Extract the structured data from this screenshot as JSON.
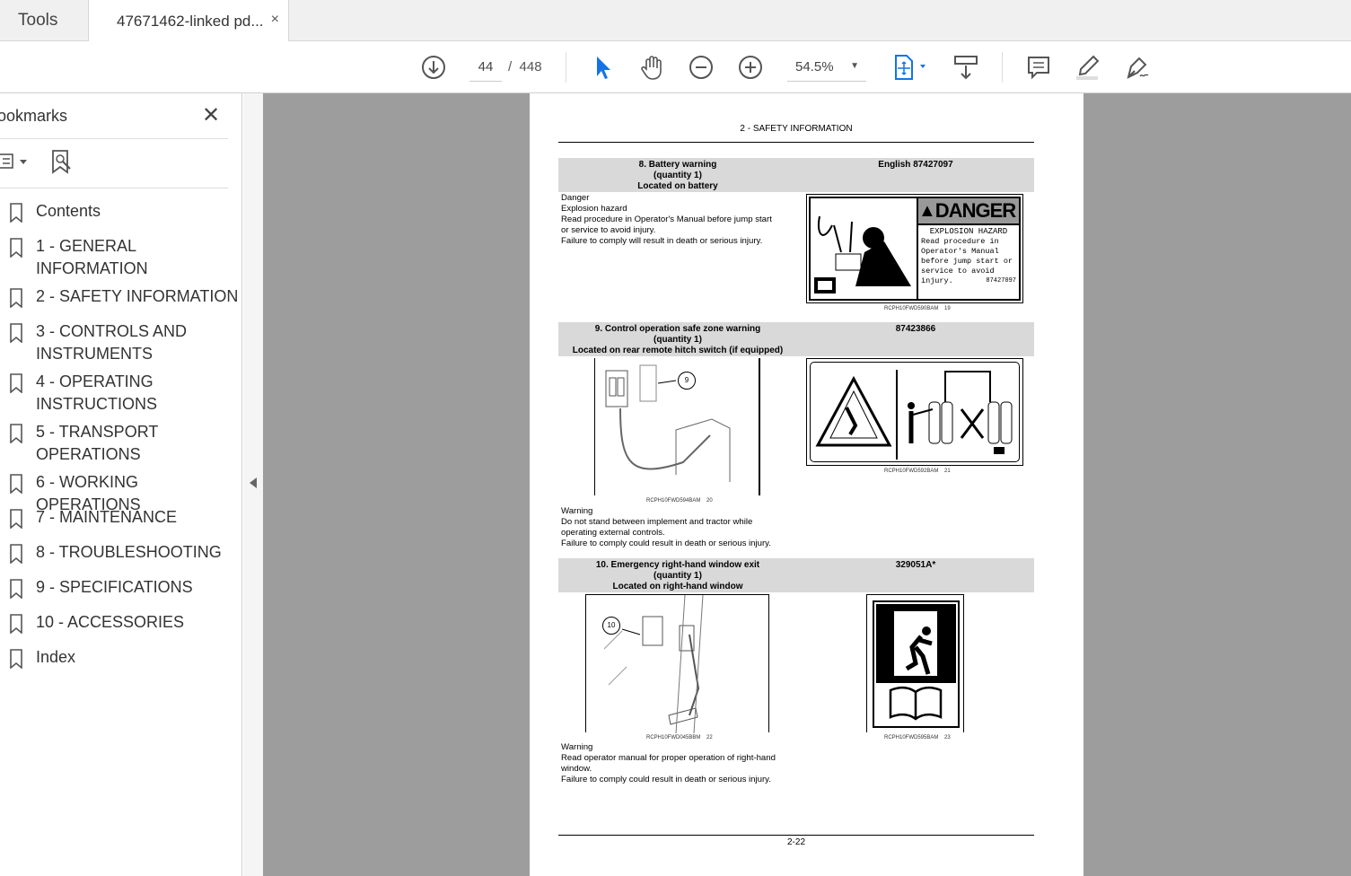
{
  "tabs": {
    "tools": "Tools",
    "document": "47671462-linked pd...",
    "close": "×"
  },
  "toolbar": {
    "page_current": "44",
    "page_sep": "/",
    "page_total": "448",
    "zoom": "54.5%"
  },
  "sidebar": {
    "title": "ookmarks",
    "close": "✕",
    "items": [
      {
        "label": [
          "Contents"
        ]
      },
      {
        "label": [
          "1 - GENERAL",
          "INFORMATION"
        ]
      },
      {
        "label": [
          "2 - SAFETY INFORMATION"
        ]
      },
      {
        "label": [
          "3 - CONTROLS AND",
          "INSTRUMENTS"
        ]
      },
      {
        "label": [
          "4 - OPERATING",
          "INSTRUCTIONS"
        ]
      },
      {
        "label": [
          "5 - TRANSPORT",
          "OPERATIONS"
        ]
      },
      {
        "label": [
          "6 - WORKING OPERATIONS"
        ]
      },
      {
        "label": [
          "7 - MAINTENANCE"
        ]
      },
      {
        "label": [
          "8 - TROUBLESHOOTING"
        ]
      },
      {
        "label": [
          "9 - SPECIFICATIONS"
        ]
      },
      {
        "label": [
          "10 - ACCESSORIES"
        ]
      },
      {
        "label": [
          "Index"
        ]
      }
    ]
  },
  "page": {
    "header": "2 - SAFETY INFORMATION",
    "footer": "2-22",
    "s8": {
      "title": "8. Battery warning",
      "qty": "(quantity 1)",
      "loc": "Located on battery",
      "code": "English 87427097",
      "text": [
        "Danger",
        "Explosion hazard",
        "Read procedure in Operator's Manual before jump start",
        "or service to avoid injury.",
        "Failure to comply will result in death or serious injury."
      ],
      "decal": {
        "danger": "DANGER",
        "hazard": "EXPLOSION HAZARD",
        "lines": [
          "Read procedure in",
          "Operator's Manual",
          "before jump start or",
          "service to avoid",
          "injury."
        ],
        "num": "87427097"
      },
      "cap": "RCPH10FWD590BAM",
      "fig": "19"
    },
    "s9": {
      "title": "9. Control operation safe zone warning",
      "qty": "(quantity 1)",
      "loc": "Located on rear remote hitch switch (if equipped)",
      "code": "87423866",
      "callout": "9",
      "text": [
        "Warning",
        "Do not stand between implement and tractor while",
        "operating external controls.",
        "Failure to comply could result in death or serious injury."
      ],
      "cap1": "RCPH10FWD594BAM",
      "fig1": "20",
      "cap2": "RCPH10FWD592BAM",
      "fig2": "21"
    },
    "s10": {
      "title": "10. Emergency right-hand window exit",
      "qty": "(quantity 1)",
      "loc": "Located on right-hand window",
      "code": "329051A*",
      "callout": "10",
      "text": [
        "Warning",
        "Read operator manual for proper operation of right-hand",
        "window.",
        "Failure to comply could result in death or serious injury."
      ],
      "cap1": "RCPH10FWD045BBM",
      "fig1": "22",
      "cap2": "RCPH10FWD595BAM",
      "fig2": "23"
    }
  },
  "colors": {
    "accent": "#1473e6",
    "viewer_bg": "#9d9d9d",
    "band": "#d9d9d9"
  }
}
